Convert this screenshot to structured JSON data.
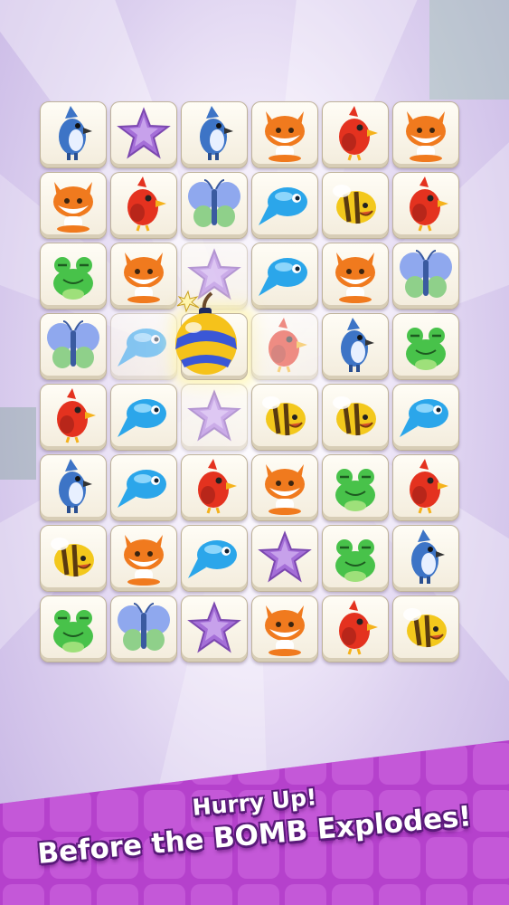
{
  "banner": {
    "line1": "Hurry Up!",
    "line2": "Before the BOMB Explodes!"
  },
  "board": {
    "columns": 6,
    "rows": 8,
    "tiles": [
      [
        "jay",
        "star",
        "jay",
        "fox",
        "bird",
        "fox"
      ],
      [
        "fox",
        "bird",
        "butterfly",
        "fish",
        "bee",
        "bird"
      ],
      [
        "frog",
        "fox",
        "star",
        "fish",
        "fox",
        "butterfly"
      ],
      [
        "butterfly",
        "fish",
        "bomb",
        "bird",
        "jay",
        "frog"
      ],
      [
        "bird",
        "fish",
        "star",
        "bee",
        "bee",
        "fish"
      ],
      [
        "jay",
        "fish",
        "bird",
        "fox",
        "frog",
        "bird"
      ],
      [
        "bee",
        "fox",
        "fish",
        "star",
        "frog",
        "jay"
      ],
      [
        "frog",
        "butterfly",
        "star",
        "fox",
        "bird",
        "bee"
      ]
    ]
  },
  "colors": {
    "star": "#a56fd8",
    "fox": "#f07a1e",
    "bird": "#e4321f",
    "jay": "#3d74c6",
    "fish": "#2ba6ea",
    "frog": "#48c24a",
    "bee": "#f3c81c",
    "butterfly": "#7aa7e8",
    "bomb_body": "#f5c21b",
    "bomb_stripe": "#3a57d6",
    "banner": "#c251d8"
  },
  "icons": {
    "jay": "blue-jay-icon",
    "star": "purple-star-icon",
    "fox": "fox-icon",
    "bird": "red-bird-icon",
    "butterfly": "butterfly-icon",
    "fish": "blue-fish-icon",
    "bee": "bee-icon",
    "frog": "frog-icon",
    "bomb": "bomb-icon"
  }
}
